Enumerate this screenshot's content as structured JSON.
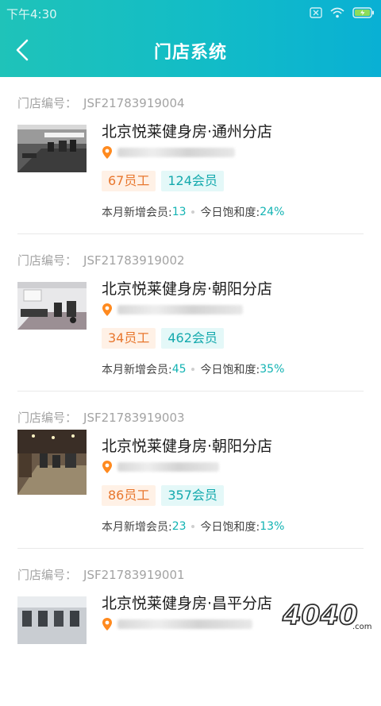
{
  "status_bar": {
    "time": "下午4:30"
  },
  "header": {
    "title": "门店系统"
  },
  "code_label": "门店编号：",
  "stats_labels": {
    "new_members": "本月新增会员:",
    "saturation": "今日饱和度:"
  },
  "colors": {
    "header_start": "#1fc3b9",
    "header_end": "#09b0d4",
    "staff_tag": "#e8772e",
    "member_tag": "#14a9ad",
    "accent": "#12b3b3"
  },
  "stores": [
    {
      "code": "JSF21783919004",
      "name": "北京悦莱健身房·通州分店",
      "staff": "67员工",
      "members": "124会员",
      "new_members": "13",
      "saturation": "24%"
    },
    {
      "code": "JSF21783919002",
      "name": "北京悦莱健身房·朝阳分店",
      "staff": "34员工",
      "members": "462会员",
      "new_members": "45",
      "saturation": "35%"
    },
    {
      "code": "JSF21783919003",
      "name": "北京悦莱健身房·朝阳分店",
      "staff": "86员工",
      "members": "357会员",
      "new_members": "23",
      "saturation": "13%"
    },
    {
      "code": "JSF21783919001",
      "name": "北京悦莱健身房·昌平分店"
    }
  ],
  "watermark": "4040"
}
